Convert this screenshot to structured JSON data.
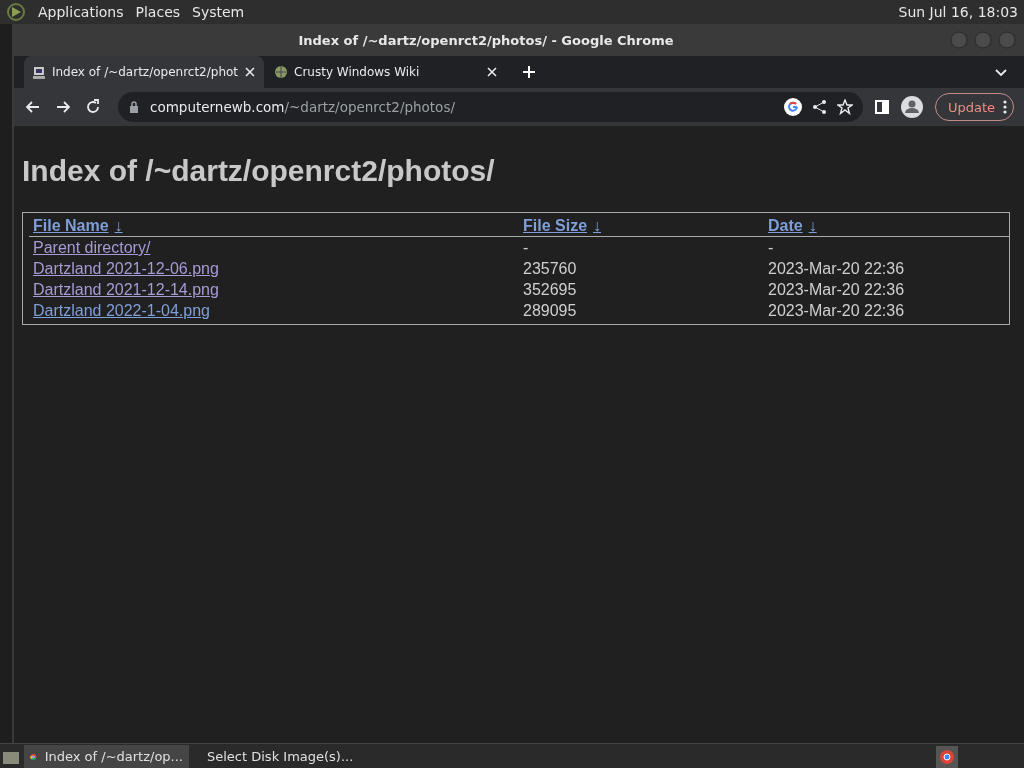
{
  "top_panel": {
    "menus": [
      "Applications",
      "Places",
      "System"
    ],
    "clock": "Sun Jul 16, 18:03"
  },
  "window": {
    "title": "Index of /~dartz/openrct2/photos/ - Google Chrome"
  },
  "tabs": [
    {
      "label": "Index of /~dartz/openrct2/phot",
      "selected": true
    },
    {
      "label": "Crusty Windows Wiki",
      "selected": false
    }
  ],
  "address_bar": {
    "host": "computernewb.com",
    "path": "/~dartz/openrct2/photos/"
  },
  "update_button": "Update",
  "page": {
    "heading": "Index of /~dartz/openrct2/photos/",
    "columns": [
      {
        "label": "File Name",
        "sort_mark": "↓"
      },
      {
        "label": "File Size",
        "sort_mark": "↓"
      },
      {
        "label": "Date",
        "sort_mark": "↓"
      }
    ],
    "rows": [
      {
        "name": "Parent directory/",
        "visited": true,
        "size": "-",
        "date": "-"
      },
      {
        "name": "Dartzland 2021-12-06.png",
        "visited": true,
        "size": "235760",
        "date": "2023-Mar-20 22:36"
      },
      {
        "name": "Dartzland 2021-12-14.png",
        "visited": true,
        "size": "352695",
        "date": "2023-Mar-20 22:36"
      },
      {
        "name": "Dartzland 2022-1-04.png",
        "visited": false,
        "size": "289095",
        "date": "2023-Mar-20 22:36"
      }
    ]
  },
  "taskbar": {
    "items": [
      {
        "label": "Index of /~dartz/op...",
        "selected": true
      },
      {
        "label": "Select Disk Image(s)...",
        "selected": false
      }
    ]
  }
}
